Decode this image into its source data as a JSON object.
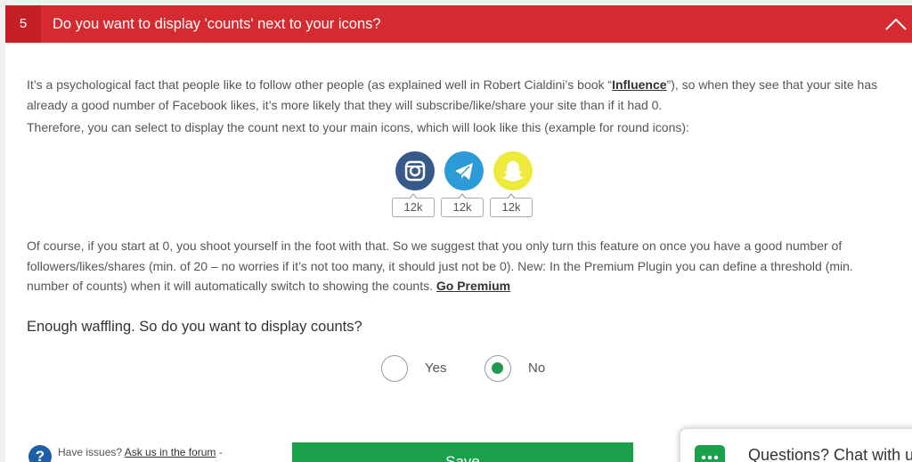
{
  "header": {
    "step_number": "5",
    "title": "Do you want to display 'counts' next to your icons?",
    "color": "#d52b30"
  },
  "intro": {
    "text1": "It’s a psychological fact that people like to follow other people (as explained well in Robert Cialdini’s book “",
    "link": "Influence",
    "text2": "”), so when they see that your site has already a good number of Facebook likes, it’s more likely that they will subscribe/like/share your site than if it had 0."
  },
  "therefore": "Therefore, you can select to display the count next to your main icons, which will look like this (example for round icons):",
  "example_icons": [
    {
      "name": "instagram-icon",
      "color": "#36598a",
      "count": "12k"
    },
    {
      "name": "telegram-icon",
      "color": "#2d9bd8",
      "count": "12k"
    },
    {
      "name": "snapchat-icon",
      "color": "#eeea3c",
      "count": "12k"
    }
  ],
  "warning": {
    "text": "Of course, if you start at 0, you shoot yourself in the foot with that. So we suggest that you only turn this feature on once you have a good number of followers/likes/shares (min. of 20 – no worries if it’s not too many, it should just not be 0). New: In the Premium Plugin you can define a threshold (min. number of counts) when it will automatically switch to showing the counts. ",
    "link": "Go Premium"
  },
  "question": "Enough waffling. So do you want to display counts?",
  "options": {
    "yes": "Yes",
    "no": "No",
    "selected": "No"
  },
  "footer": {
    "help_icon_glyph": "?",
    "help_text": "Have issues? ",
    "help_link": "Ask us in the forum",
    "help_suffix": " -",
    "save_label": "Save",
    "save_color": "#1aa24b"
  },
  "chat": {
    "label": "Questions? Chat with us!"
  }
}
